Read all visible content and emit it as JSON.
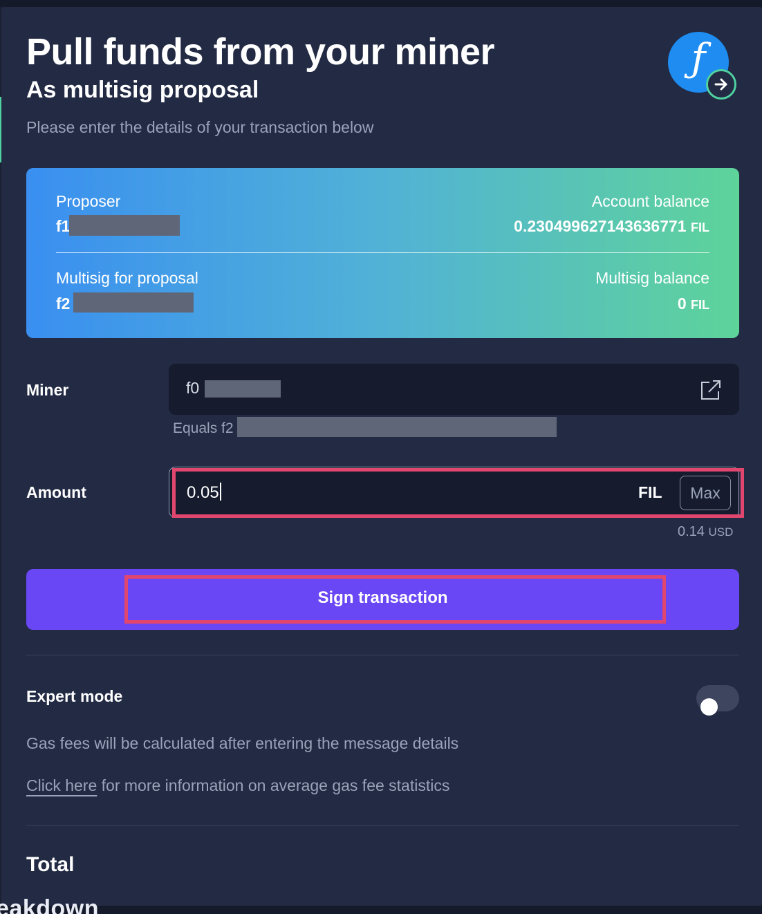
{
  "header": {
    "title": "Pull funds from your miner",
    "subtitle": "As multisig proposal",
    "helper": "Please enter the details of your transaction below"
  },
  "logo": {
    "glyph": "ƒ",
    "icon": "filecoin-logo-icon",
    "badge_icon": "arrow-right-circle-icon"
  },
  "info_card": {
    "proposer_label": "Proposer",
    "proposer_prefix": "f1",
    "account_balance_label": "Account balance",
    "account_balance_value": "0.230499627143636771",
    "account_balance_unit": "FIL",
    "multisig_label": "Multisig for proposal",
    "multisig_prefix": "f2",
    "multisig_balance_label": "Multisig balance",
    "multisig_balance_value": "0",
    "multisig_balance_unit": "FIL"
  },
  "miner": {
    "label": "Miner",
    "value_prefix": "f0",
    "equals_prefix": "Equals f2",
    "icon": "external-link-icon"
  },
  "amount": {
    "label": "Amount",
    "value": "0.05",
    "unit": "FIL",
    "max_label": "Max",
    "usd_value": "0.14",
    "usd_unit": "USD"
  },
  "sign_button": {
    "label": "Sign transaction"
  },
  "expert_mode": {
    "label": "Expert mode",
    "enabled": false
  },
  "gas": {
    "note": "Gas fees will be calculated after entering the message details",
    "link_text": "Click here",
    "link_suffix": " for more information on average gas fee statistics"
  },
  "total": {
    "label": "Total"
  },
  "footer": {
    "partial_text": "eakdown"
  },
  "colors": {
    "background": "#222a44",
    "accent": "#6a47f4",
    "highlight": "#e0466e",
    "filecoin_blue": "#1e8cf0",
    "green": "#4fd1a0"
  }
}
